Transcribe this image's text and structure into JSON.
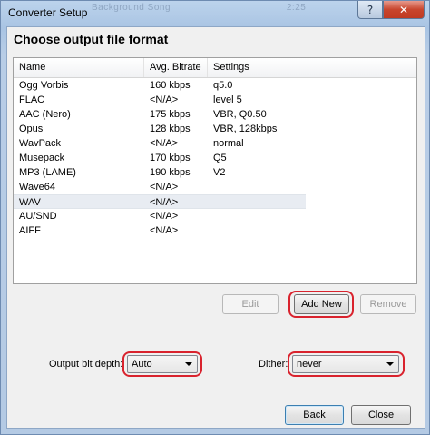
{
  "window": {
    "title": "Converter Setup",
    "ghost_text": "Background Song",
    "ghost_value": "2:25"
  },
  "dialog": {
    "heading": "Choose output file format",
    "columns": [
      "Name",
      "Avg. Bitrate",
      "Settings"
    ],
    "formats": [
      {
        "name": "Ogg Vorbis",
        "bitrate": "160 kbps",
        "settings": "q5.0"
      },
      {
        "name": "FLAC",
        "bitrate": "<N/A>",
        "settings": "level 5"
      },
      {
        "name": "AAC (Nero)",
        "bitrate": "175 kbps",
        "settings": "VBR, Q0.50"
      },
      {
        "name": "Opus",
        "bitrate": "128 kbps",
        "settings": "VBR, 128kbps"
      },
      {
        "name": "WavPack",
        "bitrate": "<N/A>",
        "settings": "normal"
      },
      {
        "name": "Musepack",
        "bitrate": "170 kbps",
        "settings": "Q5"
      },
      {
        "name": "MP3 (LAME)",
        "bitrate": "190 kbps",
        "settings": "V2"
      },
      {
        "name": "Wave64",
        "bitrate": "<N/A>",
        "settings": ""
      },
      {
        "name": "WAV",
        "bitrate": "<N/A>",
        "settings": ""
      },
      {
        "name": "AU/SND",
        "bitrate": "<N/A>",
        "settings": ""
      },
      {
        "name": "AIFF",
        "bitrate": "<N/A>",
        "settings": ""
      }
    ],
    "selected_format": "WAV",
    "buttons": {
      "edit": "Edit",
      "add_new": "Add New",
      "remove": "Remove",
      "back": "Back",
      "close": "Close"
    },
    "bit_depth": {
      "label": "Output bit depth:",
      "value": "Auto"
    },
    "dither": {
      "label": "Dither:",
      "value": "never"
    }
  },
  "colors": {
    "highlight": "#d9232e",
    "selection": "#e8ecf2"
  },
  "icons": {
    "help": "question-mark-icon",
    "close": "x-close-icon"
  }
}
